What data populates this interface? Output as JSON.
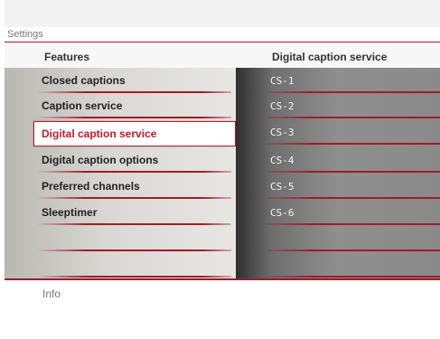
{
  "title": "Settings",
  "headers": {
    "left": "Features",
    "right": "Digital caption service"
  },
  "features": [
    {
      "label": "Closed captions"
    },
    {
      "label": "Caption service"
    },
    {
      "label": "Digital caption service",
      "selected": true
    },
    {
      "label": "Digital caption options"
    },
    {
      "label": "Preferred channels"
    },
    {
      "label": "Sleeptimer"
    },
    {
      "label": ""
    },
    {
      "label": ""
    }
  ],
  "options": [
    {
      "label": "CS-1"
    },
    {
      "label": "CS-2"
    },
    {
      "label": "CS-3"
    },
    {
      "label": "CS-4"
    },
    {
      "label": "CS-5"
    },
    {
      "label": "CS-6"
    },
    {
      "label": ""
    },
    {
      "label": ""
    }
  ],
  "footer": {
    "info_label": "Info"
  },
  "colors": {
    "accent": "#a01b2a",
    "selected_text": "#c01b2e"
  }
}
